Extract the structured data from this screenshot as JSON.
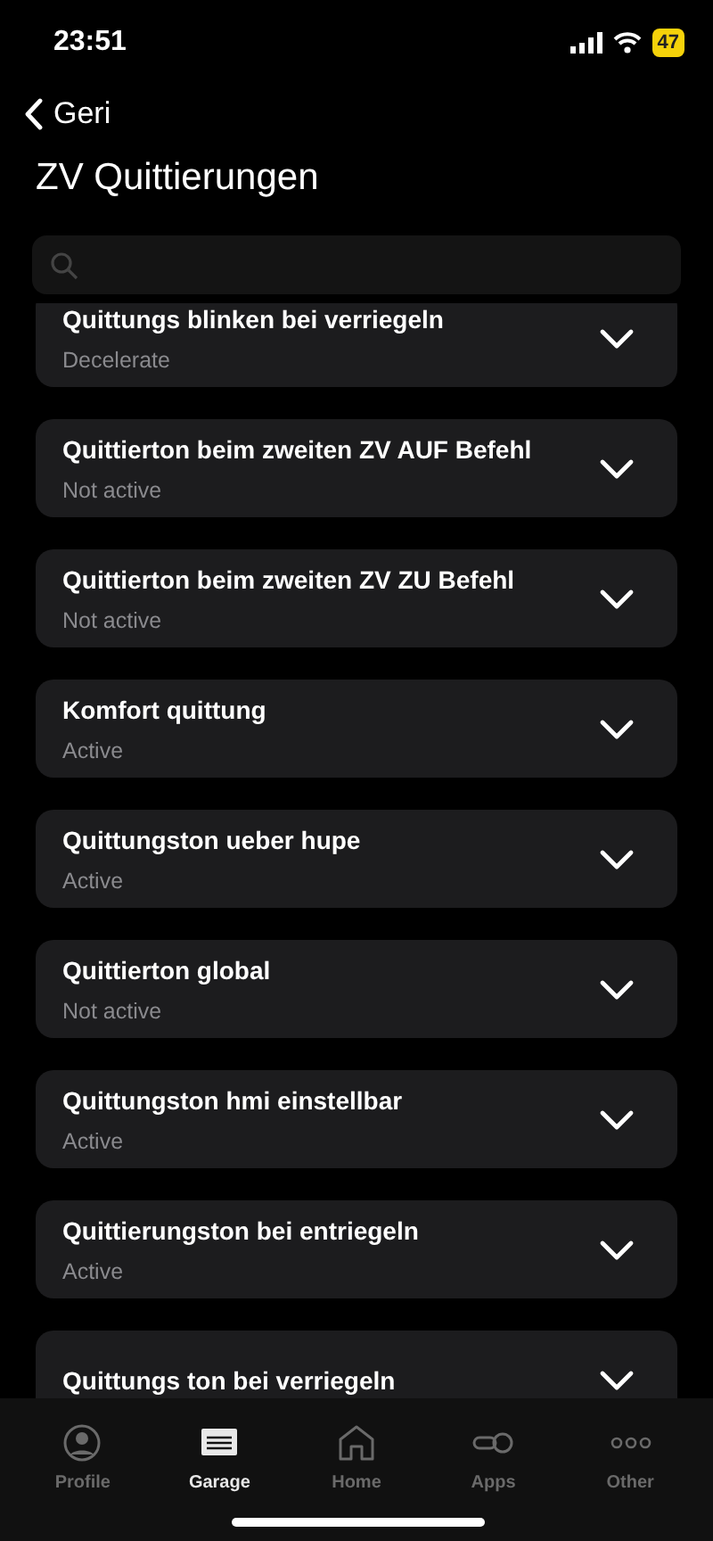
{
  "status_bar": {
    "time": "23:51",
    "battery": "47"
  },
  "nav": {
    "back_label": "Geri",
    "title": "ZV Quittierungen"
  },
  "settings": [
    {
      "title": "Quittungs blinken bei verriegeln",
      "value": "Decelerate"
    },
    {
      "title": "Quittierton beim zweiten ZV AUF Befehl",
      "value": "Not active"
    },
    {
      "title": "Quittierton beim zweiten ZV ZU Befehl",
      "value": "Not active"
    },
    {
      "title": "Komfort quittung",
      "value": "Active"
    },
    {
      "title": "Quittungston ueber hupe",
      "value": "Active"
    },
    {
      "title": "Quittierton global",
      "value": "Not active"
    },
    {
      "title": "Quittungston hmi einstellbar",
      "value": "Active"
    },
    {
      "title": "Quittierungston bei entriegeln",
      "value": "Active"
    },
    {
      "title": "Quittungs ton bei verriegeln"
    }
  ],
  "tab_bar": [
    {
      "kind": "profile",
      "label": "Profile",
      "selected": false
    },
    {
      "kind": "garage",
      "label": "Garage",
      "selected": true
    },
    {
      "kind": "home",
      "label": "Home",
      "selected": false
    },
    {
      "kind": "apps",
      "label": "Apps",
      "selected": false
    },
    {
      "kind": "other",
      "label": "Other",
      "selected": false
    }
  ]
}
